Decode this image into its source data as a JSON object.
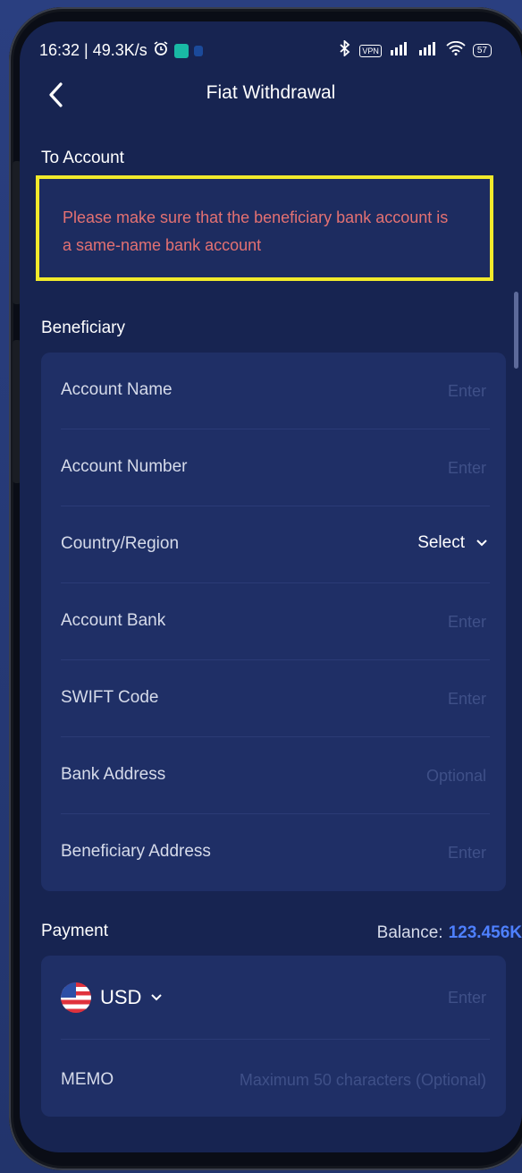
{
  "status_bar": {
    "time_speed": "16:32 | 49.3K/s",
    "vpn": "VPN",
    "battery": "57"
  },
  "header": {
    "title": "Fiat Withdrawal"
  },
  "to_account": {
    "label": "To Account",
    "notice": "Please make sure that the beneficiary bank account is a same-name bank account"
  },
  "beneficiary": {
    "label": "Beneficiary",
    "fields": [
      {
        "label": "Account Name",
        "placeholder": "Enter"
      },
      {
        "label": "Account Number",
        "placeholder": "Enter"
      },
      {
        "label": "Country/Region",
        "select": "Select"
      },
      {
        "label": "Account Bank",
        "placeholder": "Enter"
      },
      {
        "label": "SWIFT Code",
        "placeholder": "Enter"
      },
      {
        "label": "Bank Address",
        "placeholder": "Optional"
      },
      {
        "label": "Beneficiary Address",
        "placeholder": "Enter"
      }
    ]
  },
  "payment": {
    "label": "Payment",
    "balance_label": "Balance:",
    "balance_value": "123.456K",
    "currency": "USD",
    "amount_placeholder": "Enter",
    "memo_label": "MEMO",
    "memo_placeholder": "Maximum 50 characters (Optional)"
  },
  "colors": {
    "background": "#172451",
    "card": "#1f2f66",
    "notice_text": "#e47172",
    "highlight_border": "#f1ea2b",
    "accent": "#4e80ff"
  },
  "icons": [
    "back-arrow-icon",
    "chevron-down-icon",
    "us-flag-icon",
    "alarm-icon",
    "bluetooth-icon",
    "signal-icon",
    "wifi-icon",
    "battery-icon"
  ]
}
